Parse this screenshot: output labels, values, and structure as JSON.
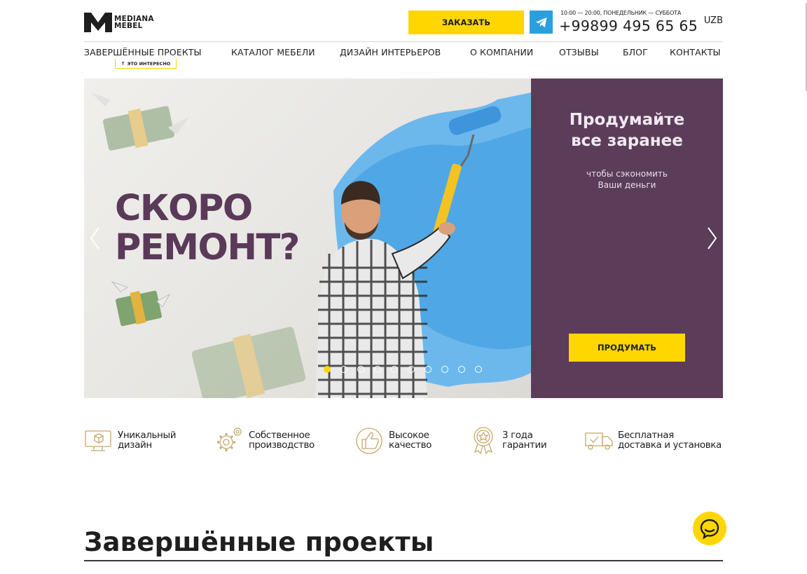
{
  "header": {
    "logo_line1": "MEDIANA",
    "logo_line2": "MEBEL",
    "order_label": "ЗАКАЗАТЬ",
    "hours": "10:00 — 20:00, ПОНЕДЕЛЬНИК — СУББОТА",
    "phone": "+99899 495 65 65",
    "lang": "UZB"
  },
  "nav": {
    "items": [
      "ЗАВЕРШЁННЫЕ ПРОЕКТЫ",
      "КАТАЛОГ МЕБЕЛИ",
      "ДИЗАЙН ИНТЕРЬЕРОВ",
      "О КОМПАНИИ",
      "ОТЗЫВЫ",
      "БЛОГ",
      "КОНТАКТЫ"
    ],
    "badge": "ЭТО ИНТЕРЕСНО"
  },
  "hero": {
    "headline_line1": "СКОРО",
    "headline_line2": "РЕМОНТ?",
    "panel_title_line1": "Продумайте",
    "panel_title_line2": "все заранее",
    "panel_sub_line1": "чтобы сэкономить",
    "panel_sub_line2": "Ваши деньги",
    "panel_button": "ПРОДУМАТЬ",
    "slides_total": 10,
    "active_slide": 1
  },
  "features": [
    {
      "icon": "design-icon",
      "line1": "Уникальный",
      "line2": "дизайн"
    },
    {
      "icon": "gears-icon",
      "line1": "Собственное",
      "line2": "производство"
    },
    {
      "icon": "thumbs-up-icon",
      "line1": "Высокое",
      "line2": "качество"
    },
    {
      "icon": "award-icon",
      "line1": "3 года",
      "line2": "гарантии"
    },
    {
      "icon": "truck-icon",
      "line1": "Бесплатная",
      "line2": "доставка и установка"
    }
  ],
  "section": {
    "title": "Завершённые проекты"
  },
  "colors": {
    "accent": "#ffd600",
    "panel": "#5b3d59",
    "headline": "#5a3a58",
    "telegram": "#2b9fde",
    "icon_line": "#c7a86a"
  }
}
